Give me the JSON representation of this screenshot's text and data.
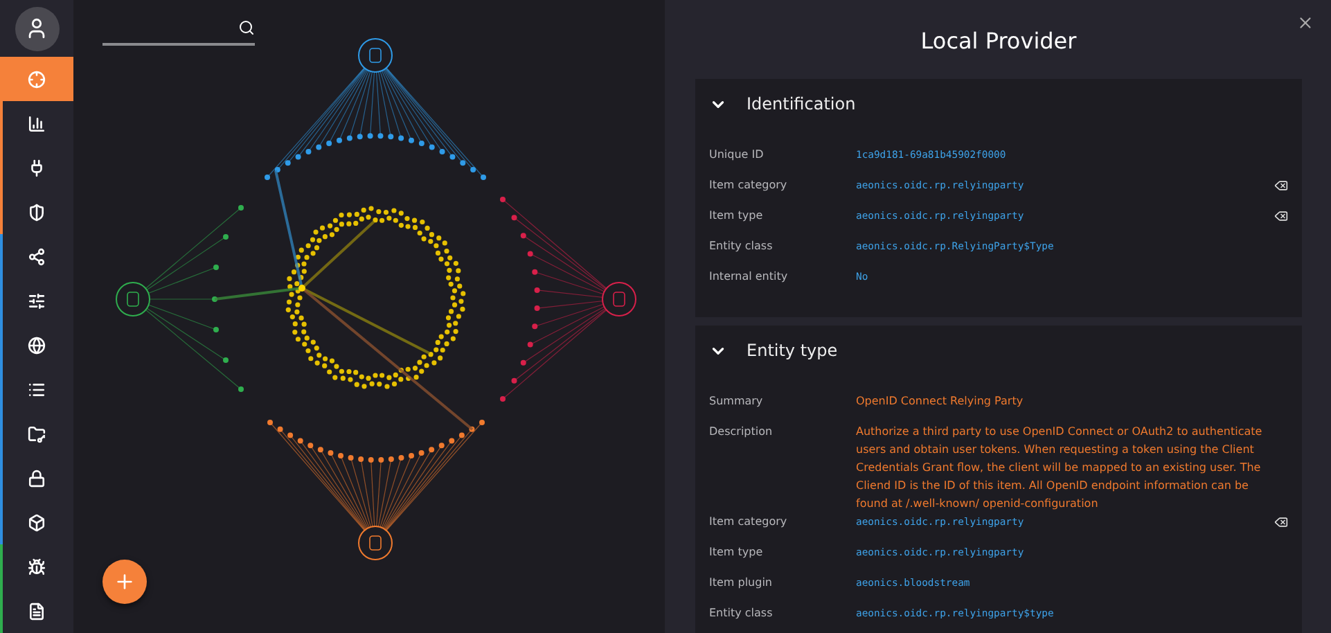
{
  "sidebar": {
    "groups": [
      {
        "color": "#f5813a",
        "items": [
          {
            "selected": true
          },
          {
            "selected": false
          },
          {
            "selected": false
          },
          {
            "selected": false
          }
        ]
      },
      {
        "color": "#2f8fe0",
        "items": [
          {
            "selected": false
          },
          {
            "selected": false
          },
          {
            "selected": false
          },
          {
            "selected": false
          },
          {
            "selected": false
          },
          {
            "selected": false
          },
          {
            "selected": false
          }
        ]
      },
      {
        "color": "#2fae4e",
        "items": [
          {
            "selected": false
          },
          {
            "selected": false
          }
        ]
      }
    ]
  },
  "panel": {
    "title": "Local Provider",
    "sections": [
      {
        "title": "Identification",
        "expanded": true,
        "rows": [
          {
            "label": "Unique ID",
            "value": "1ca9d181-69a81b45902f0000",
            "kind": "code",
            "action": false
          },
          {
            "label": "Item category",
            "value": "aeonics.oidc.rp.relyingparty",
            "kind": "code",
            "action": true
          },
          {
            "label": "Item type",
            "value": "aeonics.oidc.rp.relyingparty",
            "kind": "code",
            "action": true
          },
          {
            "label": "Entity class",
            "value": "aeonics.oidc.rp.RelyingParty$Type",
            "kind": "code",
            "action": false
          },
          {
            "label": "Internal entity",
            "value": "No",
            "kind": "code",
            "action": false
          }
        ]
      },
      {
        "title": "Entity type",
        "expanded": true,
        "rows": [
          {
            "label": "Summary",
            "value": "OpenID Connect Relying Party",
            "kind": "text",
            "action": false
          },
          {
            "label": "Description",
            "value": "Authorize a third party to use OpenID Connect or OAuth2 to authenticate users and obtain user tokens. When requesting a token using the Client Credentials Grant flow, the client will be mapped to an existing user. The Cliend ID is the ID of this item. All OpenID endpoint information can be found at /.well-known/ openid-configuration",
            "kind": "text",
            "action": false
          },
          {
            "label": "Item category",
            "value": "aeonics.oidc.rp.relyingparty",
            "kind": "code",
            "action": true
          },
          {
            "label": "Item type",
            "value": "aeonics.oidc.rp.relyingparty",
            "kind": "code",
            "action": false
          },
          {
            "label": "Item plugin",
            "value": "aeonics.bloodstream",
            "kind": "code",
            "action": false
          },
          {
            "label": "Entity class",
            "value": "aeonics.oidc.rp.relyingparty$type",
            "kind": "code",
            "action": false
          }
        ]
      }
    ]
  }
}
